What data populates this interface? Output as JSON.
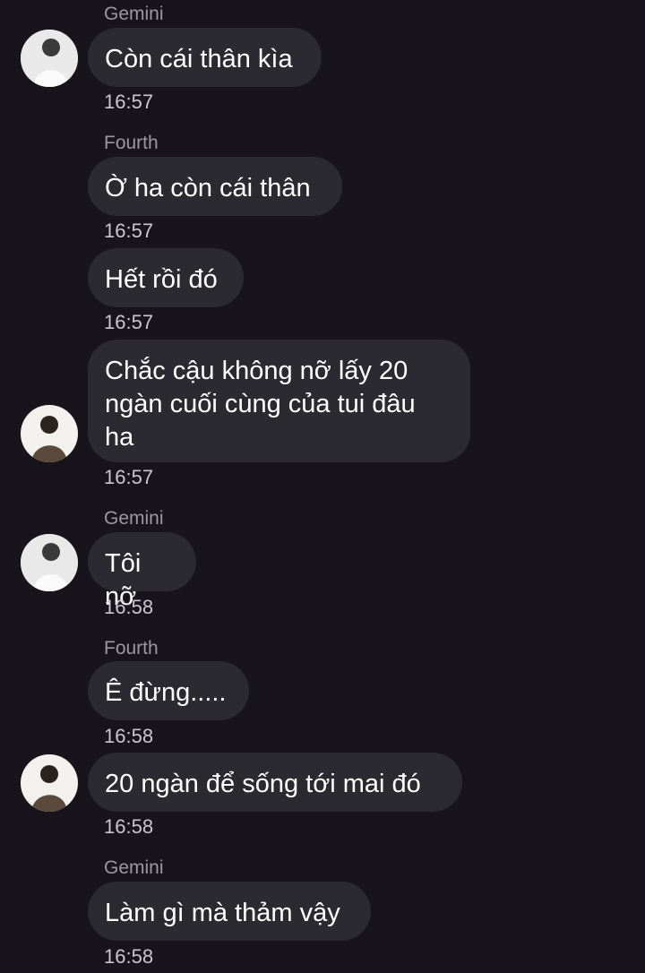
{
  "messages": [
    {
      "sender": "Gemini",
      "text": "Còn cái thân kìa",
      "time": "16:57",
      "avatar": "gemini"
    },
    {
      "sender": "Fourth",
      "text": "Ờ ha còn cái thân",
      "time": "16:57"
    },
    {
      "sender": "",
      "text": "Hết rồi đó",
      "time": "16:57"
    },
    {
      "sender": "",
      "text": "Chắc cậu không nỡ lấy 20\nngàn cuối cùng của tui đâu\nha",
      "time": "16:57",
      "avatar": "fourth"
    },
    {
      "sender": "Gemini",
      "text": "Tôi nỡ",
      "time": "16:58",
      "avatar": "gemini"
    },
    {
      "sender": "Fourth",
      "text": "Ê đừng.....",
      "time": "16:58"
    },
    {
      "sender": "",
      "text": "20 ngàn để sống tới mai đó",
      "time": "16:58",
      "avatar": "fourth"
    },
    {
      "sender": "Gemini",
      "text": "Làm gì mà thảm vậy",
      "time": "16:58"
    }
  ]
}
